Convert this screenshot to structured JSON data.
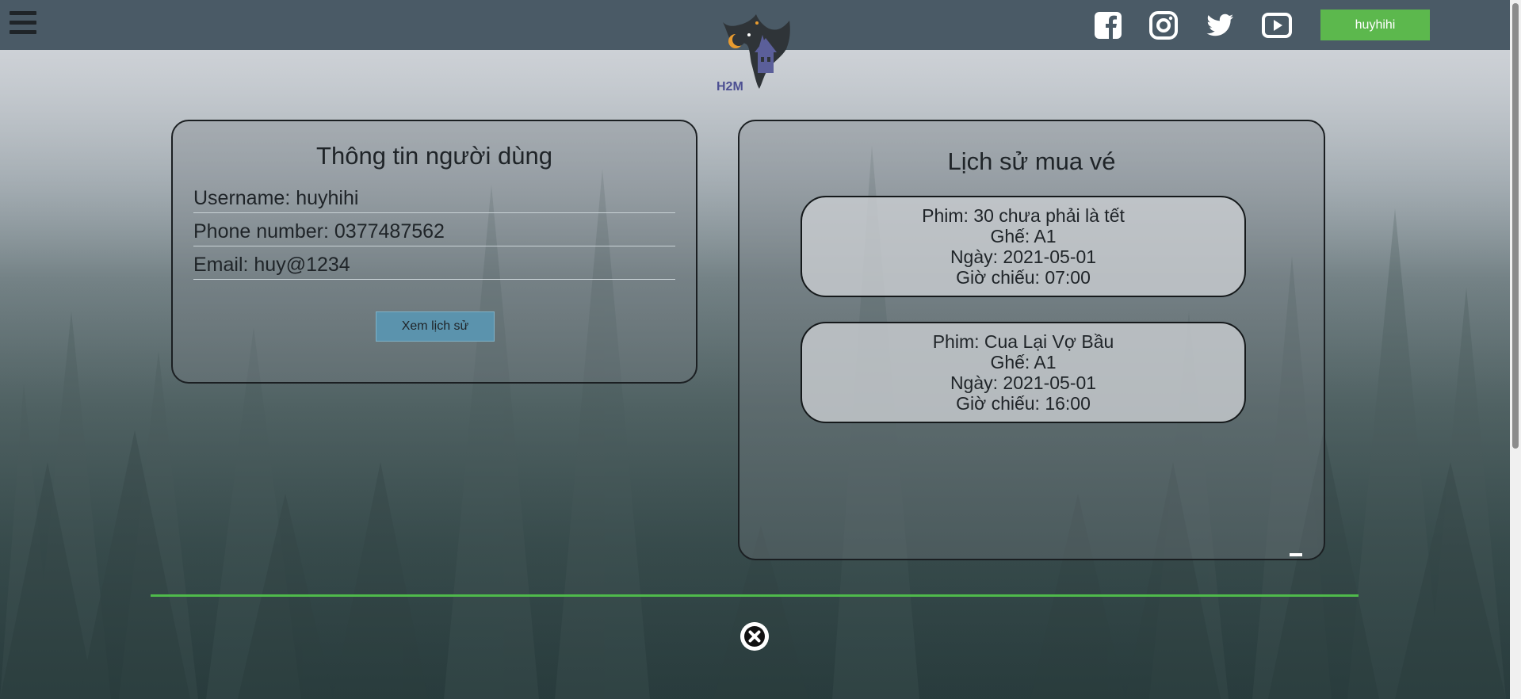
{
  "header": {
    "menu_icon": "hamburger-menu-icon",
    "logo_text": "H2M",
    "social": [
      {
        "name": "facebook-icon"
      },
      {
        "name": "instagram-icon"
      },
      {
        "name": "twitter-icon"
      },
      {
        "name": "youtube-icon"
      }
    ],
    "user_label": "huyhihi"
  },
  "user_panel": {
    "title": "Thông tin người dùng",
    "username_line": "Username: huyhihi",
    "phone_line": "Phone number: 0377487562",
    "email_line": "Email: huy@1234",
    "button_label": "Xem lịch sử"
  },
  "history_panel": {
    "title": "Lịch sử mua vé",
    "tickets": [
      {
        "movie": "Phim: 30 chưa phải là tết",
        "seat": "Ghế: A1",
        "date": "Ngày: 2021-05-01",
        "time": "Giờ chiếu: 07:00"
      },
      {
        "movie": "Phim: Cua Lại Vợ Bầu",
        "seat": "Ghế: A1",
        "date": "Ngày: 2021-05-01",
        "time": "Giờ chiếu: 16:00"
      }
    ]
  },
  "colors": {
    "header_bg": "#4a5a66",
    "accent_green": "#5cb84d",
    "button_blue": "#5b93ad"
  },
  "footer": {
    "close_icon": "close-circle-icon"
  }
}
